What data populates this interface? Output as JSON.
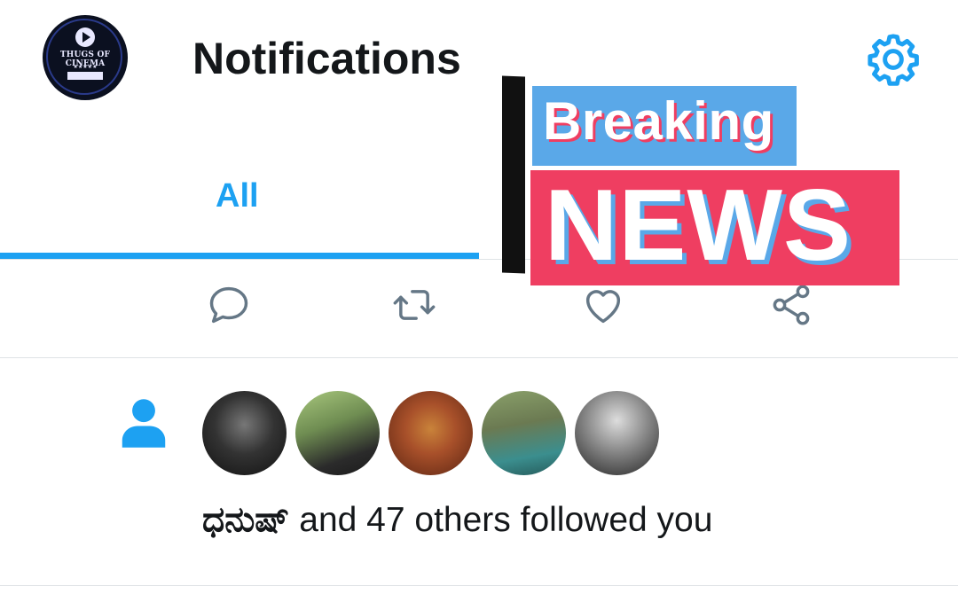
{
  "header": {
    "title": "Notifications",
    "avatar": {
      "logo_text": "THUGS OF CINEMA",
      "logo_sub": "TOIC"
    }
  },
  "tabs": [
    {
      "label": "All",
      "active": true
    }
  ],
  "tweet_actions": [
    "reply-icon",
    "retweet-icon",
    "like-icon",
    "share-icon"
  ],
  "overlay": {
    "breaking": "Breaking",
    "news": "NEWS"
  },
  "notification": {
    "icon": "person-icon",
    "follower_avatars_count": 5,
    "name": "ಧನುಷ್",
    "text": " and 47 others followed you"
  },
  "colors": {
    "accent": "#1da1f2",
    "text": "#14171a",
    "news_pink": "#ef3e61",
    "news_blue": "#5aa8e8"
  }
}
